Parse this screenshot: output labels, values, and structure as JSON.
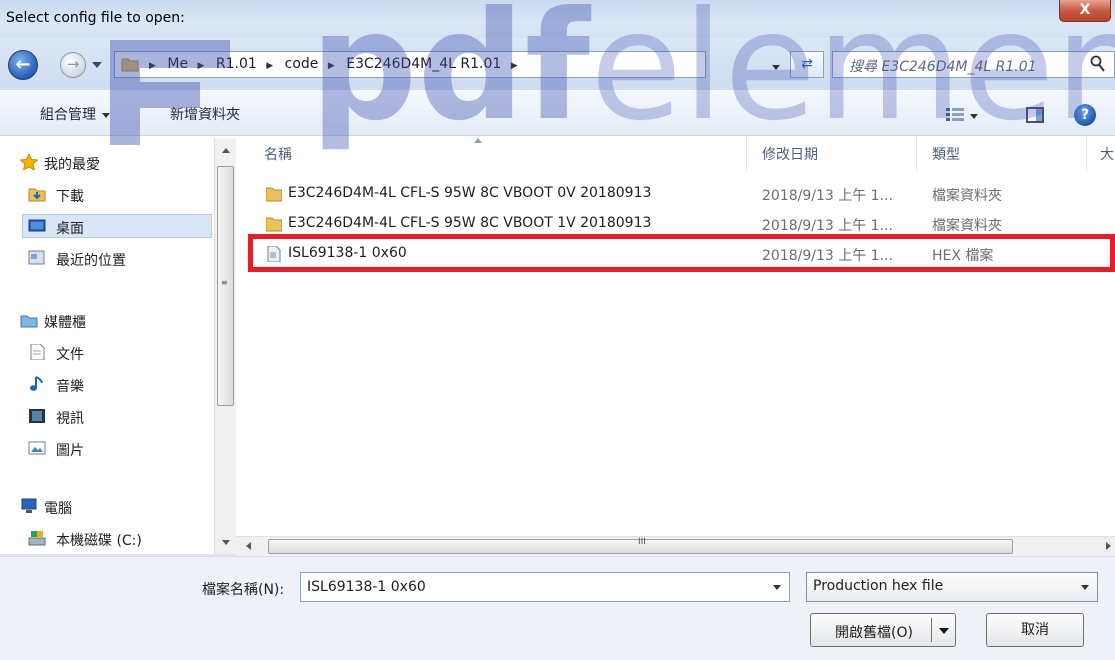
{
  "window": {
    "title": "Select config file to open:",
    "close_label": "X"
  },
  "nav": {
    "breadcrumbs": [
      "Me",
      "R1.01",
      "code",
      "E3C246D4M_4L R1.01"
    ],
    "search_placeholder": "搜尋 E3C246D4M_4L R1.01"
  },
  "toolbar": {
    "organize_label": "組合管理",
    "new_folder_label": "新增資料夾"
  },
  "sidebar": {
    "favorites_label": "我的最愛",
    "downloads_label": "下載",
    "desktop_label": "桌面",
    "recent_label": "最近的位置",
    "libraries_label": "媒體櫃",
    "documents_label": "文件",
    "music_label": "音樂",
    "videos_label": "視訊",
    "pictures_label": "圖片",
    "computer_label": "電腦",
    "local_disk_label": "本機磁碟 (C:)"
  },
  "columns": {
    "name": "名稱",
    "date": "修改日期",
    "type": "類型",
    "size": "大"
  },
  "files": [
    {
      "name": "E3C246D4M-4L CFL-S 95W 8C VBOOT 0V 20180913",
      "date": "2018/9/13 上午 1...",
      "type": "檔案資料夾",
      "kind": "folder"
    },
    {
      "name": "E3C246D4M-4L CFL-S 95W 8C VBOOT 1V 20180913",
      "date": "2018/9/13 上午 1...",
      "type": "檔案資料夾",
      "kind": "folder"
    },
    {
      "name": "ISL69138-1 0x60",
      "date": "2018/9/13 上午 1...",
      "type": "HEX 檔案",
      "kind": "file"
    }
  ],
  "scrollbar": {
    "grip_label": "III"
  },
  "footer": {
    "filename_label": "檔案名稱(N):",
    "filename_value": "ISL69138-1 0x60",
    "filter_value": "Production hex file",
    "open_label": "開啟舊檔(O)",
    "cancel_label": "取消"
  },
  "colors": {
    "highlight": "#e01f2b",
    "watermark": "#3b4fb0"
  }
}
